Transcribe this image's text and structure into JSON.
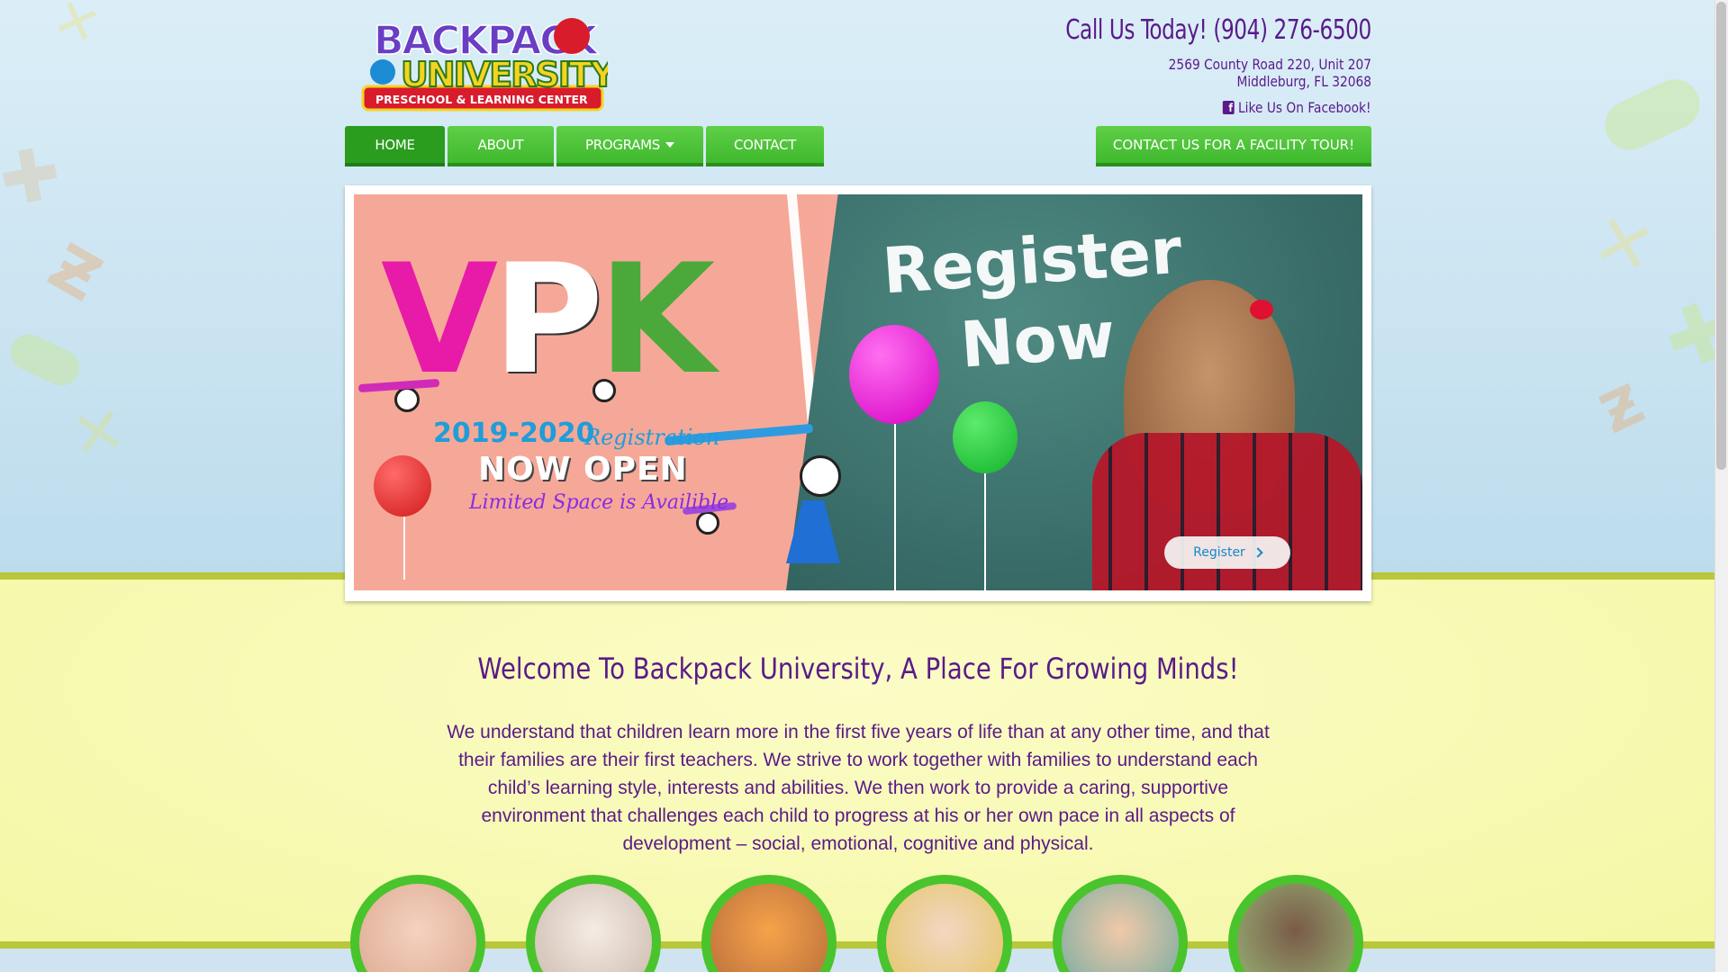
{
  "colors": {
    "brand_purple": "#5a1a8a",
    "brand_green": "#3fb92d",
    "band_lime": "#b8c83a",
    "sky": "#cfe4f0",
    "cream": "#f4f7a4"
  },
  "header": {
    "logo_alt": "Backpack University Preschool & Learning Center",
    "logo_line1": "BACKPACK",
    "logo_line2": "UNIVERSITY",
    "logo_line3": "PRESCHOOL & LEARNING CENTER",
    "call_text": "Call Us Today! (904) 276-6500",
    "address_line1": "2569 County Road 220, Unit 207",
    "address_line2": "Middleburg, FL 32068",
    "facebook_icon": "facebook-icon",
    "facebook_text": "Like Us On Facebook!"
  },
  "nav": {
    "items": [
      {
        "label": "HOME",
        "active": true
      },
      {
        "label": "ABOUT",
        "active": false
      },
      {
        "label": "PROGRAMS",
        "active": false,
        "dropdown": true
      },
      {
        "label": "CONTACT",
        "active": false
      }
    ],
    "tour_button": "CONTACT US FOR A FACILITY TOUR!"
  },
  "slider": {
    "headline_v": "V",
    "headline_p": "P",
    "headline_k": "K",
    "year": "2019-2020",
    "registration": "Registration",
    "now_open": "NOW OPEN",
    "limited": "Limited Space is Availible",
    "chalk_line1": "Register",
    "chalk_line2": "Now",
    "button_label": "Register",
    "button_icon": "chevron-right-icon"
  },
  "main": {
    "welcome_title": "Welcome To Backpack University, A Place For Growing Minds!",
    "intro_text": "We understand that children learn more in the first five years of life than at any other time, and that their families are their first teachers. We strive to work together with families to understand each child’s learning style, interests and abilities. We then work to provide a caring, supportive environment that challenges each child to progress at his or her own pace in all aspects of development – social, emotional, cognitive and physical."
  },
  "program_photos": [
    {
      "name": "infant-photo"
    },
    {
      "name": "toddlers-photo"
    },
    {
      "name": "preschool-boy-photo"
    },
    {
      "name": "children-group-photo"
    },
    {
      "name": "kids-activity-photo"
    },
    {
      "name": "boy-outdoors-photo"
    }
  ]
}
